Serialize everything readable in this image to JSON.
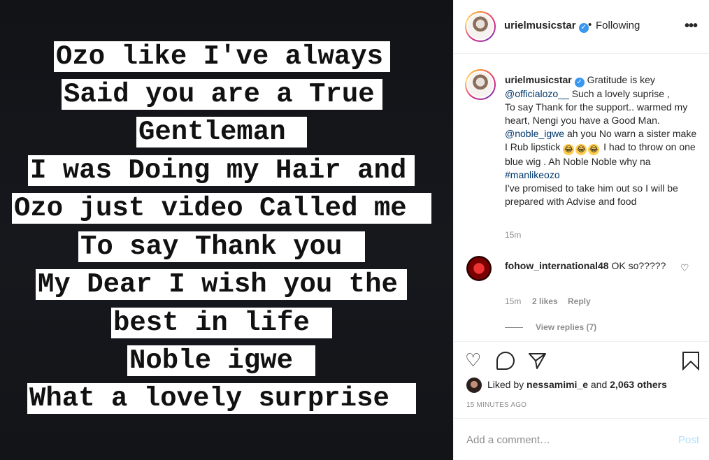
{
  "post_image": {
    "lines": [
      "Ozo like I've always",
      "Said you are a True",
      "Gentleman",
      "I was Doing my Hair and",
      "Ozo just video Called me",
      "To say Thank you",
      "My Dear I wish you the",
      "best in life",
      "Noble igwe",
      "What a lovely surprise"
    ]
  },
  "header": {
    "username": "urielmusicstar",
    "separator": "•",
    "follow_status": "Following",
    "more_label": "•••"
  },
  "caption": {
    "username": "urielmusicstar",
    "text_1": "Gratitude is key",
    "mention_1": "@officialozo__",
    "text_2": "Such a lovely suprise ,",
    "text_3": "To say Thank for the support.. warmed my heart, Nengi you have a Good Man.",
    "mention_2": "@noble_igwe",
    "text_4": "ah you No warn a sister make I Rub lipstick",
    "emoji": "😂",
    "text_5": "I had to throw on one blue wig . Ah Noble Noble why na",
    "hashtag": "#manlikeozo",
    "text_6": "I've promised to take him out so I will be prepared with Advise and food",
    "time": "15m"
  },
  "comment": {
    "username": "fohow_international48",
    "text": "OK so?????",
    "time": "15m",
    "likes": "2 likes",
    "reply": "Reply",
    "view_replies": "View replies (7)"
  },
  "actions": {
    "liked_by_prefix": "Liked by",
    "liked_by_user": "nessamimi_e",
    "liked_by_and": "and",
    "liked_by_others": "2,063 others",
    "timestamp": "15 MINUTES AGO"
  },
  "comment_box": {
    "placeholder": "Add a comment…",
    "post_label": "Post"
  }
}
